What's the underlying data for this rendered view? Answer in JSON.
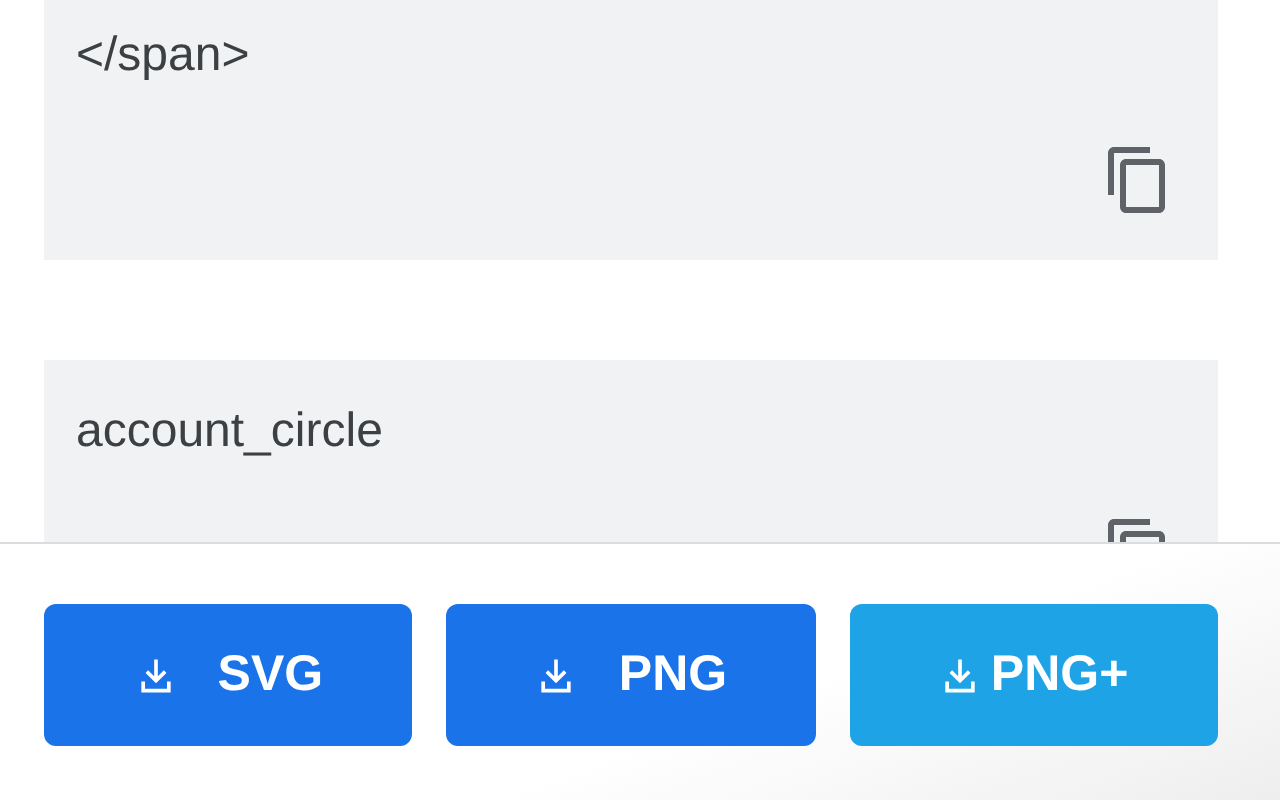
{
  "snippets": [
    {
      "code": "</span>"
    },
    {
      "code": "account_circle"
    }
  ],
  "buttons": [
    {
      "label": "SVG",
      "kind": "primary"
    },
    {
      "label": "PNG",
      "kind": "primary"
    },
    {
      "label": "PNG+",
      "kind": "accent"
    }
  ]
}
